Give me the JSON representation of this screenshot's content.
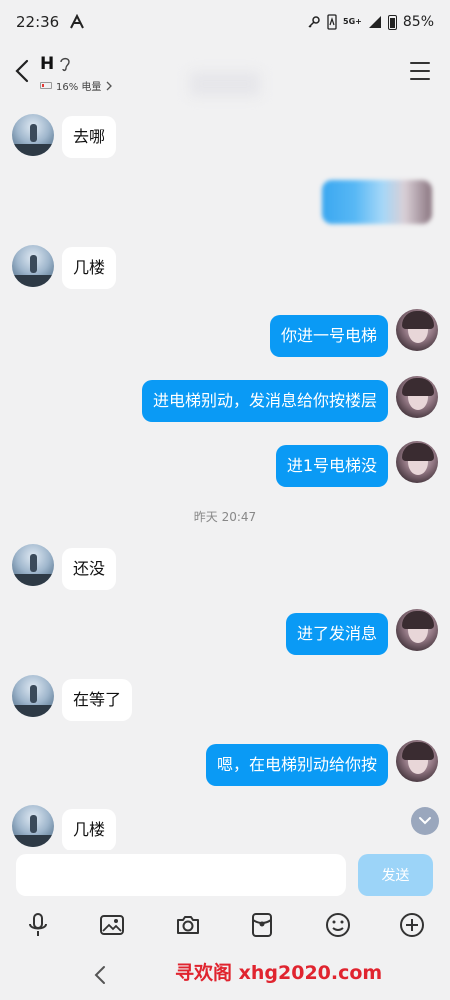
{
  "status_bar": {
    "time": "22:36",
    "network": "5G+",
    "battery_percent": "85%"
  },
  "header": {
    "contact_name": "H",
    "battery_info": "16% 电量"
  },
  "messages": [
    {
      "side": "them",
      "text": "去哪"
    },
    {
      "side": "me",
      "text": ""
    },
    {
      "side": "them",
      "text": "几楼"
    },
    {
      "side": "me",
      "text": "你进一号电梯"
    },
    {
      "side": "me",
      "text": "进电梯别动，发消息给你按楼层"
    },
    {
      "side": "me",
      "text": "进1号电梯没"
    },
    {
      "side": "them",
      "text": "还没"
    },
    {
      "side": "me",
      "text": "进了发消息"
    },
    {
      "side": "them",
      "text": "在等了"
    },
    {
      "side": "me",
      "text": "嗯，在电梯别动给你按"
    },
    {
      "side": "them",
      "text": "几楼"
    }
  ],
  "timestamp": "昨天 20:47",
  "input": {
    "placeholder": "",
    "send_label": "发送"
  },
  "watermark": "寻欢阁 xhg2020.com",
  "colors": {
    "my_bubble": "#0a9af5",
    "their_bubble": "#ffffff",
    "background": "#f1f1f2",
    "send_disabled": "#9cd4f8"
  }
}
